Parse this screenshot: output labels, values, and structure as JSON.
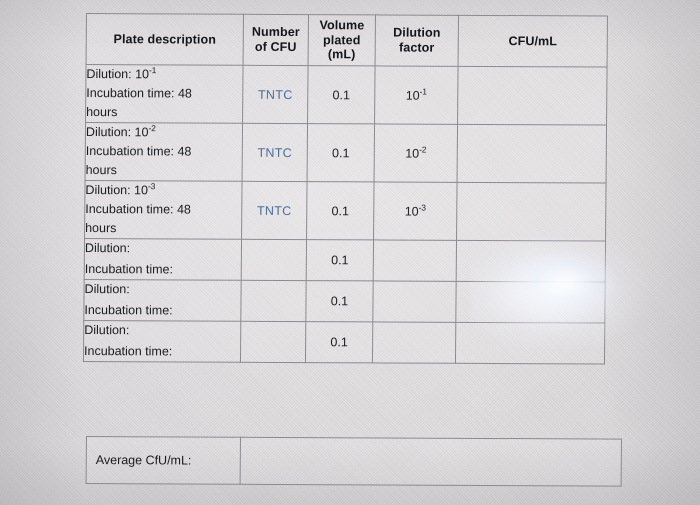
{
  "document": {
    "type": "lab-worksheet-table",
    "title_visible": false
  },
  "table": {
    "headers": [
      "Plate description",
      "Number of CFU",
      "Volume plated (mL)",
      "Dilution factor",
      "CFU/mL"
    ],
    "header_lines": {
      "plate_description": [
        "Plate description"
      ],
      "number_of_cfu": [
        "Number",
        "of CFU"
      ],
      "volume_plated": [
        "Volume",
        "plated",
        "(mL)"
      ],
      "dilution_factor": [
        "Dilution",
        "factor"
      ],
      "cfu_per_ml": [
        "CFU/mL"
      ]
    },
    "rows": [
      {
        "description_line1": "Dilution: 10",
        "description_line1_exp": "-1",
        "description_line2": "Incubation time: 48",
        "description_line3": "hours",
        "number_of_cfu": "TNTC",
        "volume_plated": "0.1",
        "dilution_factor_base": "10",
        "dilution_factor_exp": "-1",
        "cfu_per_ml": ""
      },
      {
        "description_line1": "Dilution: 10",
        "description_line1_exp": "-2",
        "description_line2": "Incubation time: 48",
        "description_line3": "hours",
        "number_of_cfu": "TNTC",
        "volume_plated": "0.1",
        "dilution_factor_base": "10",
        "dilution_factor_exp": "-2",
        "cfu_per_ml": ""
      },
      {
        "description_line1": "Dilution: 10",
        "description_line1_exp": "-3",
        "description_line2": "Incubation time: 48",
        "description_line3": "hours",
        "number_of_cfu": "TNTC",
        "volume_plated": "0.1",
        "dilution_factor_base": "10",
        "dilution_factor_exp": "-3",
        "cfu_per_ml": ""
      },
      {
        "description_line1": "Dilution:",
        "description_line1_exp": "",
        "description_line2": "Incubation time:",
        "description_line3": "",
        "number_of_cfu": "",
        "volume_plated": "0.1",
        "dilution_factor_base": "",
        "dilution_factor_exp": "",
        "cfu_per_ml": ""
      },
      {
        "description_line1": "Dilution:",
        "description_line1_exp": "",
        "description_line2": "Incubation time:",
        "description_line3": "",
        "number_of_cfu": "",
        "volume_plated": "0.1",
        "dilution_factor_base": "",
        "dilution_factor_exp": "",
        "cfu_per_ml": ""
      },
      {
        "description_line1": "Dilution:",
        "description_line1_exp": "",
        "description_line2": "Incubation time:",
        "description_line3": "",
        "number_of_cfu": "",
        "volume_plated": "0.1",
        "dilution_factor_base": "",
        "dilution_factor_exp": "",
        "cfu_per_ml": ""
      }
    ]
  },
  "average_box": {
    "label": "Average CfU/mL:",
    "value": ""
  },
  "colors": {
    "paper": "#d9d6d9",
    "border": "#8b8b90",
    "text": "#1b1c20",
    "tntc_text": "#4a6f9c",
    "glare": "#ffffff"
  }
}
